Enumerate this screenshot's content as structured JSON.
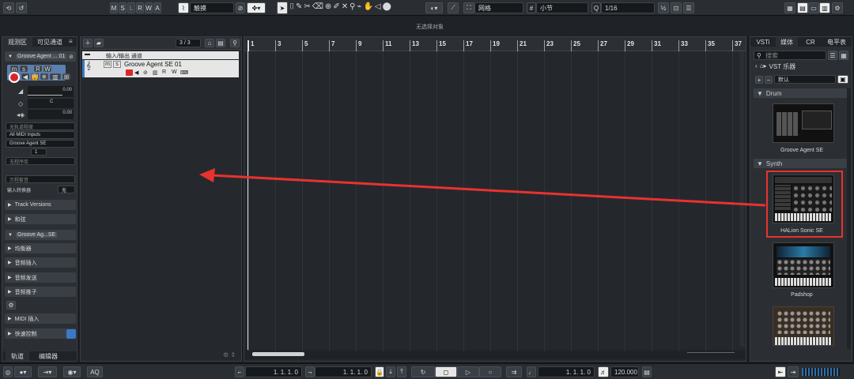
{
  "toolbar": {
    "msrwa": [
      "M",
      "S",
      "L",
      "R",
      "W",
      "A"
    ],
    "automation_mode": "触摸",
    "snap_type": "网格",
    "grid_type": "小节",
    "quantize": "1/16"
  },
  "status": {
    "no_selection": "无选择对象"
  },
  "inspector": {
    "tabs": [
      "观测区",
      "可见通道"
    ],
    "track_name": "Groove Agent ... 01",
    "vol_value": "0.00",
    "pan_value": "C",
    "delay_value": "0.00",
    "no_drum_map": "无轨道程度",
    "midi_input": "All MIDI Inputs",
    "midi_output": "Groove Agent SE",
    "channel": "1",
    "no_bank": "无程序库",
    "patch_placeholder": "示程套音",
    "input_transformer": "输入转换器",
    "input_transformer_val": "无",
    "sections": [
      {
        "label": "Track Versions"
      },
      {
        "label": "和弦"
      },
      {
        "label": "Groove Ag...SE"
      },
      {
        "label": "均衡器"
      },
      {
        "label": "音频插入"
      },
      {
        "label": "音频发送"
      },
      {
        "label": "音频推子"
      },
      {
        "label": "MIDI 插入"
      },
      {
        "label": "快速控制"
      }
    ],
    "bottom_tabs": [
      "轨道",
      "编辑器"
    ]
  },
  "tracklist": {
    "counter": "3 / 3",
    "folder_label": "输入/输出 通道",
    "track_name": "Groove Agent SE 01",
    "track_buttons": [
      "m",
      "s"
    ]
  },
  "ruler": {
    "bars": [
      "1",
      "3",
      "5",
      "7",
      "9",
      "11",
      "13",
      "15",
      "17",
      "19",
      "21",
      "23",
      "25",
      "27",
      "29",
      "31",
      "33",
      "35",
      "37"
    ]
  },
  "mediabay": {
    "tabs": [
      "VSTi",
      "媒体",
      "CR",
      "电平表"
    ],
    "search_placeholder": "搜索",
    "breadcrumb": "VST 乐器",
    "filter": "默认",
    "categories": [
      {
        "name": "Drum",
        "items": [
          "Groove Agent SE"
        ]
      },
      {
        "name": "Synth",
        "items": [
          "HALion Sonic SE",
          "Padshop",
          ""
        ]
      }
    ]
  },
  "transport": {
    "left_locator": "1. 1. 1.  0",
    "right_locator": "1. 1. 1.  0",
    "position": "1. 1. 1.  0",
    "tempo": "120.000",
    "aq": "AQ"
  },
  "colors": {
    "accent_red": "#e8322f",
    "record_red": "#d9262a",
    "select_blue": "#3c78c8"
  }
}
